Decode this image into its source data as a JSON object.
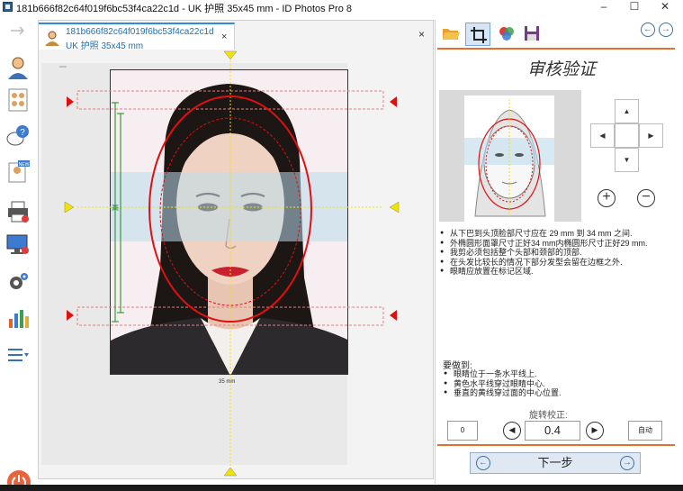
{
  "window": {
    "title": "181b666f82c64f019f6bc53f4ca22c1d - UK 护照 35x45 mm - ID Photos Pro 8",
    "minimize": "–",
    "maximize": "☐",
    "close": "✕"
  },
  "document_tab": {
    "line1": "181b666f82c64f019f6bc53f4ca22c1d",
    "line2": "UK 护照 35x45 mm",
    "close": "×"
  },
  "panel_close": "×",
  "canvas": {
    "bottom_label": "35 mm",
    "side_label": "高"
  },
  "right_panel": {
    "title": "审核验证",
    "rules": [
      "从下巴到头顶脸部尺寸应在 29 mm 到 34 mm 之间.",
      "外椭圆形面罩尺寸正好34 mm内椭圆形尺寸正好29 mm.",
      "我剪必须包括整个头部和颈部的顶部.",
      "在头发比较长的情况下部分发型会留在边框之外.",
      "眼睛应放置在标记区域."
    ],
    "todo_title": "要做到:",
    "todo": [
      "眼睛位于一条水平线上.",
      "黄色水平线穿过眼睛中心.",
      "垂直的黄线穿过面的中心位置."
    ],
    "rotation_label": "旋转校正:",
    "rotation_zero": "0",
    "rotation_value": "0.4",
    "rotation_auto": "自动",
    "next_button": "下一步",
    "dpad": {
      "up": "▲",
      "down": "▼",
      "left": "◀",
      "right": "▶"
    },
    "zoom_in": "+",
    "zoom_out": "−",
    "rot_left": "◀",
    "rot_right": "▶",
    "nav_prev": "←",
    "nav_next": "→"
  },
  "colors": {
    "accent_orange": "#e26f2f",
    "tab_blue": "#2b8fd6",
    "guide_red": "#e01010",
    "guide_yellow": "#f2e200",
    "guide_green": "#1a8a1a"
  }
}
